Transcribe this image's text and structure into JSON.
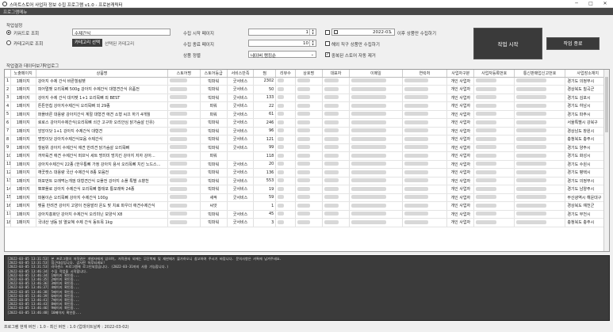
{
  "window": {
    "title": "스마트스토어 사업자 정보 수집 프로그램 v1.0 - 프로본캐릭터",
    "minimize": "─",
    "maximize": "□",
    "close": "✕"
  },
  "menu": {
    "item": "프로그램메뉴"
  },
  "settings": {
    "group_label": "작업설정",
    "radio_keyword": "키워드로 조회",
    "radio_category": "카테고리로 조회",
    "keyword_value": "수제간식",
    "category_button": "카테고리 선택",
    "category_placeholder": "선택된 카테고리",
    "start_page_label": "수집 시작 페이지",
    "start_page_value": "1",
    "end_page_label": "수집 종료 페이지",
    "end_page_value": "10",
    "sort_label": "상품 정렬",
    "sort_value": "네이버 랭킹순",
    "date_value": "2022-03",
    "date_suffix": "이후 상품만 수집하기",
    "opt_overseas": "해외 직구 상품만 수집하기",
    "opt_dedupe": "중복된 스토어 자동 제거",
    "start_button": "작업 시작",
    "exit_button": "작업 종료"
  },
  "tabs": [
    "작업결과 데이터보기",
    "작업로그"
  ],
  "table": {
    "columns": [
      "",
      "노출페이지",
      "상품명",
      "스토어명",
      "스토어등급",
      "서비스만족",
      "찜",
      "리뷰수",
      "상호명",
      "대표자",
      "이메일",
      "연락처",
      "사업자구분",
      "사업자등록번호",
      "통신판매업신고번호",
      "사업장소재지"
    ],
    "rows": [
      [
        "1",
        "1페이지",
        "강아지 수제 간식 바른힐링펫",
        "",
        "빅파워",
        "굿서비스",
        "2302",
        "",
        "",
        "",
        "",
        "",
        "개인 사업자",
        "",
        "",
        "경기도 의정부시"
      ],
      [
        "2",
        "1페이지",
        "피어멀펫 오리목뼈 500g 강아지 수제간식 대형견간식 유품전",
        "",
        "빅파워",
        "굿서비스",
        "50",
        "",
        "",
        "",
        "",
        "",
        "개인 사업자",
        "",
        "",
        "경상북도 칠곡군"
      ],
      [
        "3",
        "1페이지",
        "강아지 수제 간식 대지펫 1+1 오리목뼈 외 BEST",
        "",
        "빅파워",
        "굿서비스",
        "133",
        "",
        "",
        "",
        "",
        "",
        "개인 사업자",
        "",
        "",
        "경기도 김포시"
      ],
      [
        "4",
        "1페이지",
        "튼튼한칩 강아지수제간식 오리목뼈 외 29종",
        "",
        "파워",
        "굿서비스",
        "22",
        "",
        "",
        "",
        "",
        "",
        "개인 사업자",
        "",
        "",
        "경기도 하남시"
      ],
      [
        "5",
        "1페이지",
        "퍼플바른 대용량 강아지간식 계절 대형견 애견 소형 씨끄 하기 4개월",
        "",
        "파워",
        "굿서비스",
        "61",
        "",
        "",
        "",
        "",
        "",
        "개인 사업자",
        "",
        "",
        "경기도 파주시"
      ],
      [
        "6",
        "1페이지",
        "로로스 강아지수제간식(오리목뼈 쇠간 고구마 오리안심 닭가슴살 인유)",
        "",
        "빅파워",
        "굿서비스",
        "246",
        "",
        "",
        "",
        "",
        "",
        "개인 사업자",
        "",
        "",
        "서울특별시 강북구"
      ],
      [
        "7",
        "1페이지",
        "앙앙이닷 1+1 강아지 수제간식 대형견",
        "",
        "빅파워",
        "굿서비스",
        "96",
        "",
        "",
        "",
        "",
        "",
        "개인 사업자",
        "",
        "",
        "경상남도 창원시"
      ],
      [
        "8",
        "1페이지",
        "멍멍이닷 강아지수제간식모음 수제간식",
        "",
        "빅파워",
        "굿서비스",
        "121",
        "",
        "",
        "",
        "",
        "",
        "개인 사업자",
        "",
        "",
        "충청북도 충주시"
      ],
      [
        "9",
        "1페이지",
        "힐링위 강아지 수제간식 애견 반려견 닭가슴살 오리목뼈",
        "",
        "빅파워",
        "굿서비스",
        "99",
        "",
        "",
        "",
        "",
        "",
        "개인 사업자",
        "",
        "",
        "경기도 양주시"
      ],
      [
        "10",
        "1페이지",
        "까까육견 애견 수제간식 퍼프닉 세트 멍미미 멍치킨 강아지 저자 강아...",
        "",
        "파워",
        "",
        "118",
        "",
        "",
        "",
        "",
        "",
        "개인 사업자",
        "",
        "",
        "경기도 화성시"
      ],
      [
        "11",
        "1페이지",
        "강아지수제간식 22종 (한우통뼈 가정 강아지 용서 오리목뼈 치킨 노드스...",
        "",
        "빅파워",
        "굿서비스",
        "20",
        "",
        "",
        "",
        "",
        "",
        "개인 사업자",
        "",
        "",
        "경기도 수원시"
      ],
      [
        "12",
        "1페이지",
        "깨끗캣스 대용량 국산 수제간식 8종 모음전",
        "",
        "빅파워",
        "굿서비스",
        "136",
        "",
        "",
        "",
        "",
        "",
        "개인 사업자",
        "",
        "",
        "경기도 평택시"
      ],
      [
        "13",
        "1페이지",
        "퍼포먼트 오래먹는개껌 대형견간식 오플전 강아지 소플 특별 소향천",
        "",
        "빅파워",
        "굿서비스",
        "553",
        "",
        "",
        "",
        "",
        "",
        "개인 사업자",
        "",
        "",
        "경기도 의정부시"
      ],
      [
        "14",
        "1페이지",
        "뽀뽀플로 강아지 수제간식 오리목뼈 황태포 통모래박 24종",
        "",
        "빅파워",
        "굿서비스",
        "19",
        "",
        "",
        "",
        "",
        "",
        "개인 사업자",
        "",
        "",
        "경기도 남양주시"
      ],
      [
        "15",
        "1페이지",
        "파봉이손 오리목뼈 강아지 수제간식 100g",
        "",
        "새싹",
        "굿서비스",
        "59",
        "",
        "",
        "",
        "",
        "",
        "개인 사업자",
        "",
        "",
        "부산광역시 해운대구"
      ],
      [
        "16",
        "1페이지",
        "펫룰 반려견 강아지 고양이 전용발라 온도 맞 치료 파우더 애견수제간식",
        "",
        "씨앗",
        "",
        "1",
        "",
        "",
        "",
        "",
        "",
        "개인 사업자",
        "",
        "",
        "경상북도 예천군"
      ],
      [
        "17",
        "1페이지",
        "강아지홍화단 강아지 수제간식 오리미닌 보양식 X8",
        "",
        "빅파워",
        "굿서비스",
        "45",
        "",
        "",
        "",
        "",
        "",
        "개인 사업자",
        "",
        "",
        "경기도 부천시"
      ],
      [
        "18",
        "1페이지",
        "국내산 냉동 닭 열요혜 수제 간식 동트목 1kg",
        "",
        "빅파워",
        "굿서비스",
        "3",
        "",
        "",
        "",
        "",
        "",
        "개인 사업자",
        "",
        "",
        "충청북도 충주시"
      ]
    ]
  },
  "log": [
    "[2022-03-05 13:31:53] 본 프로그램의 저작권은 개발자에게 있으며, 저작권자 외에는 무단복제 및 재판매가 불가하오니 참고하여 주시기 바랍니다. 문의사항은 카톡에 남겨주세요.",
    "[2022-03-05 13:31:53] 접근대상입니다. 감사한 하루되세요!",
    "[2022-03-05 13:31:53] 라이센스 프로그램에 로그인되었습니다. (2022-03-31까지 사용 가능합니다.)",
    "[2022-03-05 13:46:34] 수집 작업을 시작합니다.",
    "[2022-03-05 13:46:34] 1페이지 확인중...",
    "[2022-03-05 13:46:35] 2페이지 확인중...",
    "[2022-03-05 13:46:36] 3페이지 확인중...",
    "[2022-03-05 13:46:37] 4페이지 확인중...",
    "[2022-03-05 13:46:38] 5페이지 확인중...",
    "[2022-03-05 13:46:39] 6페이지 확인중...",
    "[2022-03-05 13:46:41] 7페이지 확인중...",
    "[2022-03-05 13:46:43] 8페이지 확인중...",
    "[2022-03-05 13:46:46] 9페이지 확인중...",
    "[2022-03-05 13:46:48] 10페이지 확인중..."
  ],
  "status": "프로그램 현재 버전 : 1.0 - 최신 버전 : 1.0 (업데이트날짜 : 2022-03-02)"
}
